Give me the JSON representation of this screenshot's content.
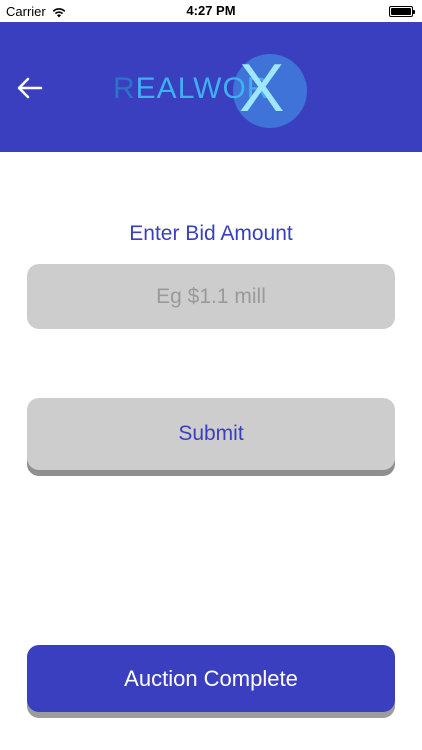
{
  "status_bar": {
    "carrier": "Carrier",
    "time": "4:27 PM",
    "wifi_icon": "wifi-icon",
    "battery_icon": "battery-icon"
  },
  "header": {
    "back_icon": "arrow-left-icon",
    "logo_text_first": "R",
    "logo_text_rest": "EALWOR",
    "logo_x": "X",
    "background_color": "#3a3fbf"
  },
  "bid": {
    "label": "Enter Bid Amount",
    "value": "",
    "placeholder": "Eg $1.1 mill"
  },
  "buttons": {
    "submit_label": "Submit",
    "auction_complete_label": "Auction Complete"
  },
  "colors": {
    "accent": "#3a3fbf",
    "input_bg": "#cdcdcd"
  }
}
